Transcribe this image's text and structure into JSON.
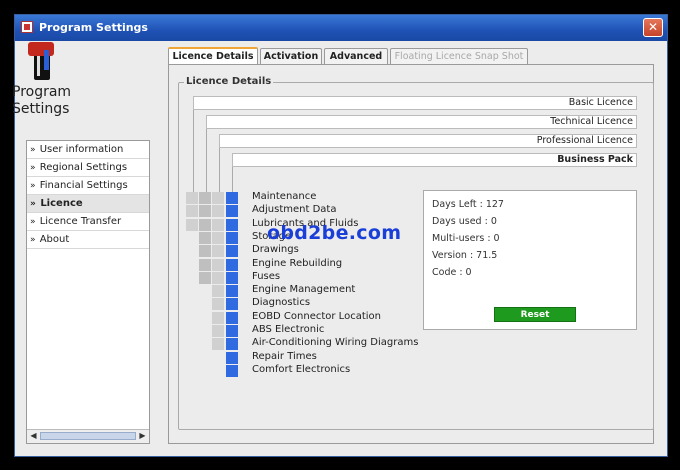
{
  "window": {
    "title": "Program Settings",
    "close_symbol": "✕"
  },
  "sidebar": {
    "app_name_line1": "Program",
    "app_name_line2": "Settings",
    "items": [
      {
        "label": "User information"
      },
      {
        "label": "Regional Settings"
      },
      {
        "label": "Financial Settings"
      },
      {
        "label": "Licence",
        "selected": true
      },
      {
        "label": "Licence Transfer"
      },
      {
        "label": "About"
      }
    ],
    "scroll_left": "◀",
    "scroll_right": "▶"
  },
  "tabs": [
    {
      "label": "Licence Details",
      "active": true
    },
    {
      "label": "Activation"
    },
    {
      "label": "Advanced"
    },
    {
      "label": "Floating Licence Snap Shot",
      "disabled": true
    }
  ],
  "licence_details": {
    "group_label": "Licence Details",
    "tiers": [
      "Basic Licence",
      "Technical Licence",
      "Professional Licence",
      "Business Pack"
    ],
    "features": [
      "Maintenance",
      "Adjustment Data",
      "Lubricants and Fluids",
      "Storage",
      "Drawings",
      "Engine Rebuilding",
      "Fuses",
      "Engine Management",
      "Diagnostics",
      "EOBD Connector Location",
      "ABS Electronic",
      "Air-Conditioning Wiring Diagrams",
      "Repair Times",
      "Comfort Electronics"
    ],
    "info": {
      "days_left": "Days Left : 127",
      "days_used": "Days used : 0",
      "multi_users": "Multi-users : 0",
      "version": "Version : 71.5",
      "code": "Code : 0"
    },
    "reset_label": "Reset"
  },
  "watermark": "obd2be.com",
  "colors": {
    "accent_blue": "#2f6ae0",
    "reset_green": "#1e9a1e",
    "title_blue": "#1f52b4"
  }
}
